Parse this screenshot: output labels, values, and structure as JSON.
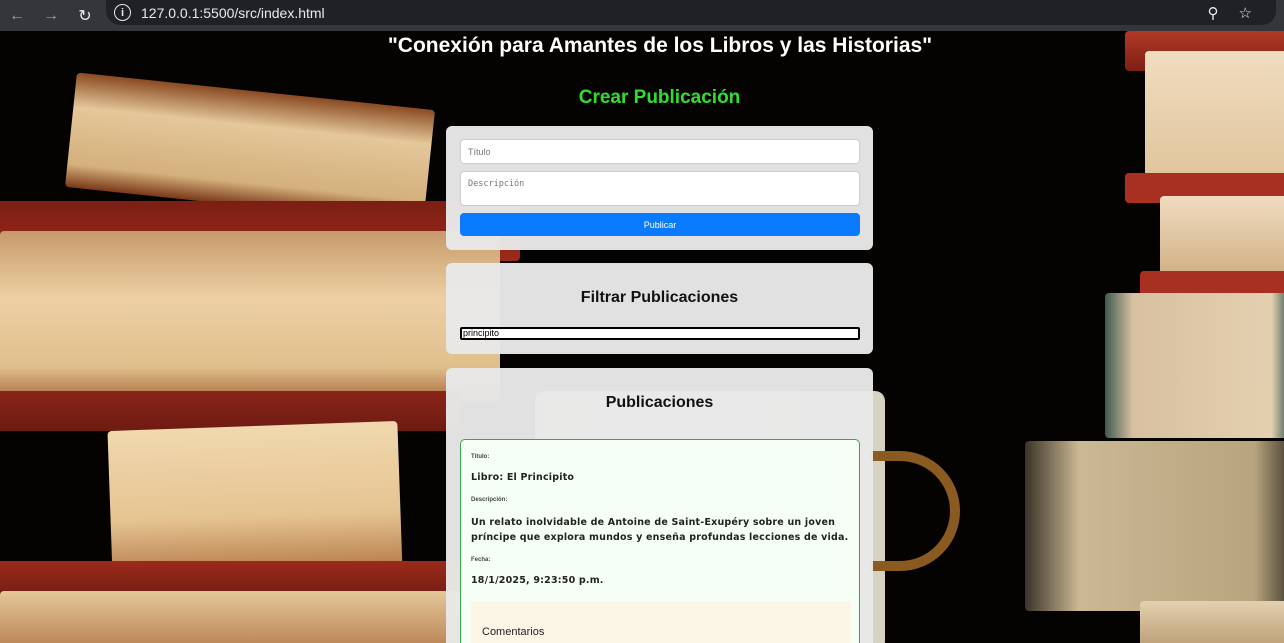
{
  "browser": {
    "url": "127.0.0.1:5500/src/index.html",
    "back_icon": "back-arrow-icon",
    "forward_icon": "forward-arrow-icon",
    "reload_icon": "reload-icon",
    "info_icon": "info-icon",
    "zoom_icon": "zoom-icon",
    "bookmark_icon": "bookmark-star-icon"
  },
  "page": {
    "title": "\"Conexión para Amantes de los Libros y las Historias\"",
    "create_heading": "Crear Publicación",
    "create_heading_color": "#2ee02e"
  },
  "create_form": {
    "title_placeholder": "Título",
    "description_placeholder": "Descripción",
    "publish_label": "Publicar",
    "publish_color": "#0a7bff"
  },
  "filter": {
    "heading": "Filtrar Publicaciones",
    "value": "principito"
  },
  "posts": {
    "heading": "Publicaciones",
    "items": [
      {
        "title_label": "Título:",
        "title": "Libro: El Principito",
        "description_label": "Descripción:",
        "description": "Un relato inolvidable de Antoine de Saint-Exupéry sobre un joven príncipe que explora mundos y enseña profundas lecciones de vida.",
        "date_label": "Fecha:",
        "date": "18/1/2025, 9:23:50 p.m.",
        "comments_heading": "Comentarios"
      }
    ]
  }
}
